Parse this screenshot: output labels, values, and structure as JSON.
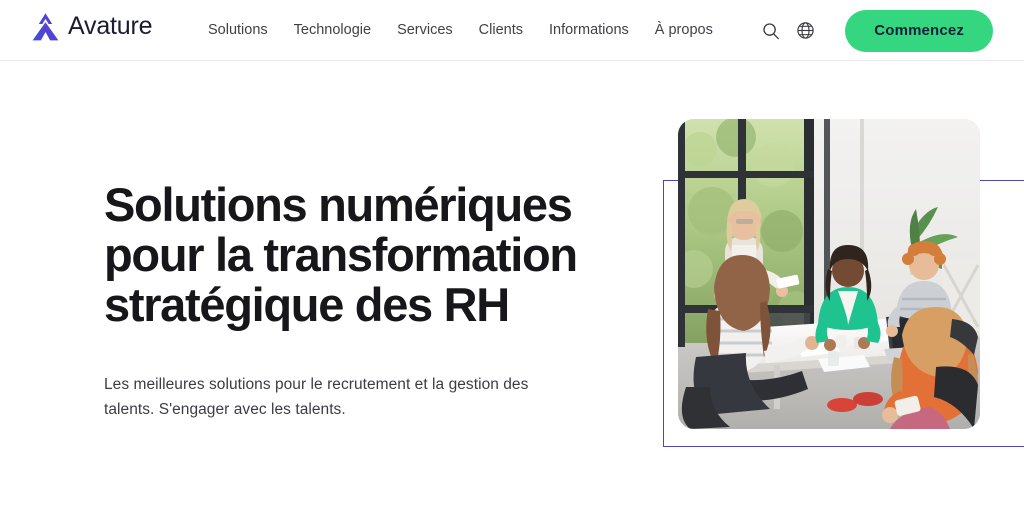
{
  "brand": {
    "name": "Avature",
    "logo_icon": "avature-a-mark-icon",
    "logo_color_start": "#3f4fd8",
    "logo_color_end": "#7a3fd8"
  },
  "nav": {
    "items": [
      {
        "label": "Solutions"
      },
      {
        "label": "Technologie"
      },
      {
        "label": "Services"
      },
      {
        "label": "Clients"
      },
      {
        "label": "Informations"
      },
      {
        "label": "À propos"
      }
    ]
  },
  "header": {
    "search_icon": "search-icon",
    "language_icon": "globe-icon",
    "cta_label": "Commencez",
    "cta_color": "#35d680",
    "cta_text_color": "#14213a",
    "border_color": "#e8e8ec"
  },
  "hero": {
    "title": "Solutions numériques pour la transformation stratégique des RH",
    "subtitle": "Les meilleures solutions pour le recrutement et la gestion des talents. S'engager avec les talents.",
    "title_color": "#17171b",
    "subtitle_color": "#3c3c44",
    "frame_color": "#5146b8",
    "photo_alt": "Équipe de cinq personnes en réunion autour d'une table blanche dans un bureau lumineux avec de grandes fenêtres"
  }
}
